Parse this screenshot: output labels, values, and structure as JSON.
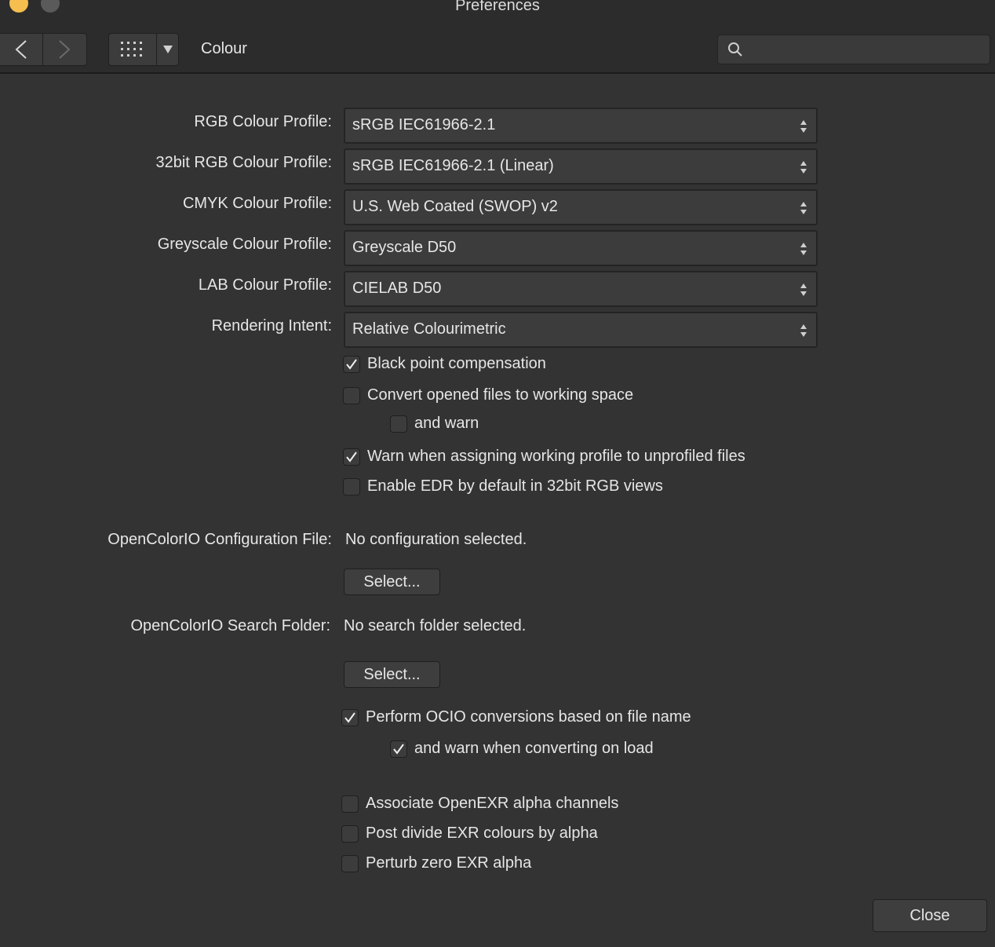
{
  "window": {
    "title": "Preferences"
  },
  "toolbar": {
    "pane_title": "Colour",
    "search_placeholder": ""
  },
  "profiles": [
    {
      "label": "RGB Colour Profile:",
      "value": "sRGB IEC61966-2.1"
    },
    {
      "label": "32bit RGB Colour Profile:",
      "value": "sRGB IEC61966-2.1 (Linear)"
    },
    {
      "label": "CMYK Colour Profile:",
      "value": "U.S. Web Coated (SWOP) v2"
    },
    {
      "label": "Greyscale Colour Profile:",
      "value": "Greyscale D50"
    },
    {
      "label": "LAB Colour Profile:",
      "value": "CIELAB D50"
    },
    {
      "label": "Rendering Intent:",
      "value": "Relative Colourimetric"
    }
  ],
  "options": {
    "black_point": {
      "label": "Black point compensation",
      "checked": true
    },
    "convert_opened": {
      "label": "Convert opened files to working space",
      "checked": false
    },
    "convert_warn": {
      "label": "and warn",
      "checked": false
    },
    "warn_assign": {
      "label": "Warn when assigning working profile to unprofiled files",
      "checked": true
    },
    "enable_edr": {
      "label": "Enable EDR by default in 32bit RGB views",
      "checked": false
    }
  },
  "ocio": {
    "config_label": "OpenColorIO Configuration File:",
    "config_value": "No configuration selected.",
    "config_select": "Select...",
    "folder_label": "OpenColorIO Search Folder:",
    "folder_value": "No search folder selected.",
    "folder_select": "Select...",
    "perform": {
      "label": "Perform OCIO conversions based on file name",
      "checked": true
    },
    "perform_warn": {
      "label": "and warn when converting on load",
      "checked": true
    }
  },
  "exr": {
    "associate": {
      "label": "Associate OpenEXR alpha channels",
      "checked": false
    },
    "post_divide": {
      "label": "Post divide EXR colours by alpha",
      "checked": false
    },
    "perturb": {
      "label": "Perturb zero EXR alpha",
      "checked": false
    }
  },
  "footer": {
    "close_label": "Close"
  }
}
